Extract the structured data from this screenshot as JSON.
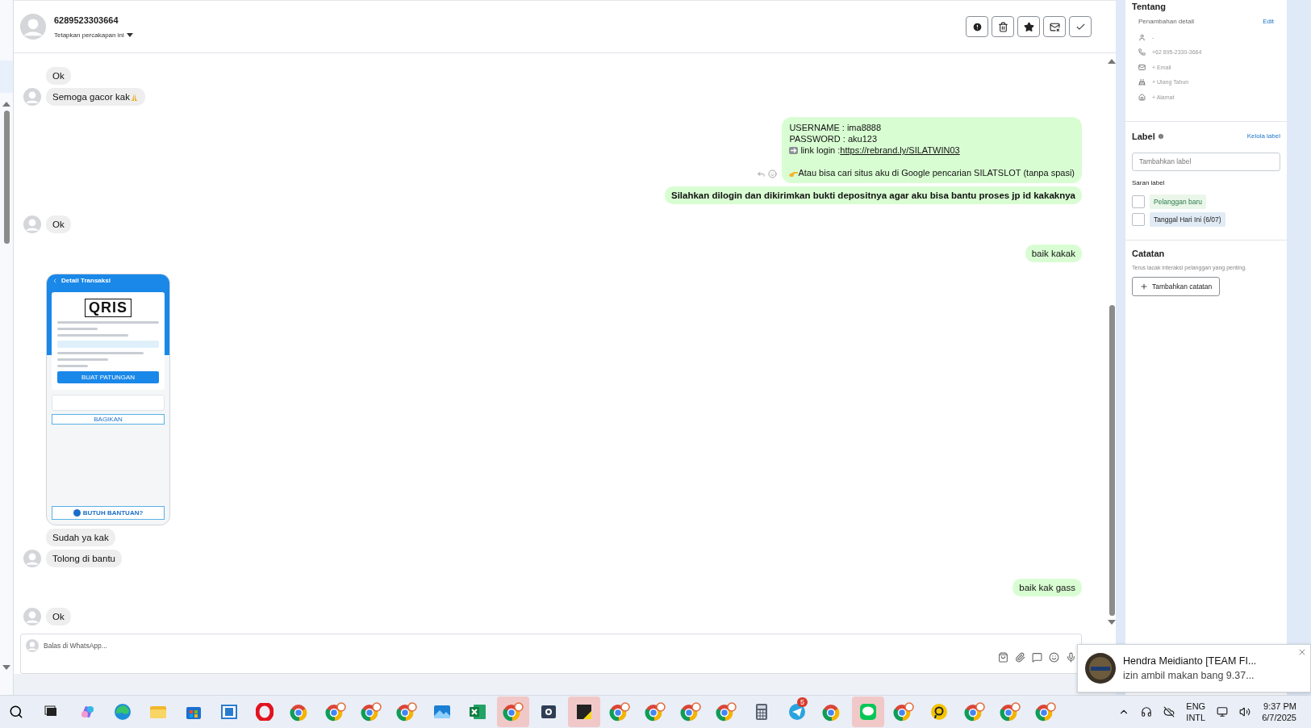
{
  "header": {
    "contact": "6289523303664",
    "assign": "Tetapkan percakapan ini"
  },
  "messages": [
    {
      "kind": "text",
      "outgoing": false,
      "text": "Ok"
    },
    {
      "kind": "text",
      "outgoing": false,
      "text": "Semoga gacor kak",
      "emoji_after": true
    },
    {
      "kind": "lines",
      "outgoing": true,
      "actions": true,
      "lines": [
        {
          "kind": "plain",
          "text": "USERNAME : ima8888"
        },
        {
          "kind": "plain",
          "text": "PASSWORD : aku123"
        },
        {
          "kind": "arrow",
          "text": "link login : ",
          "link": "https://rebrand.ly/SILATWIN03"
        },
        {
          "kind": "hand",
          "text": "Atau bisa cari situs aku di Google pencarian SILATSLOT (tanpa spasi)",
          "gap_before": true
        }
      ]
    },
    {
      "kind": "text",
      "outgoing": true,
      "bold": true,
      "text": "Silahkan dilogin dan dikirimkan bukti depositnya agar aku bisa bantu proses jp id kakaknya"
    },
    {
      "kind": "text",
      "outgoing": false,
      "text": "Ok"
    },
    {
      "kind": "text",
      "outgoing": true,
      "text": "baik kakak"
    },
    {
      "kind": "image",
      "outgoing": false,
      "title": "Detail Transaksi",
      "logo": "QRIS",
      "button": "BUAT PATUNGAN",
      "share": "BAGIKAN",
      "help": "BUTUH BANTUAN?"
    },
    {
      "kind": "text",
      "outgoing": false,
      "text": "Sudah ya kak"
    },
    {
      "kind": "text",
      "outgoing": false,
      "text": "Tolong di bantu"
    },
    {
      "kind": "text",
      "outgoing": true,
      "text": "baik kak gass"
    },
    {
      "kind": "text",
      "outgoing": false,
      "text": "Ok"
    }
  ],
  "composer": {
    "placeholder": "Balas di WhatsApp..."
  },
  "about": {
    "title": "Tentang",
    "subtitle": "Penambahan detail",
    "edit": "Edit",
    "details": [
      {
        "kind": "person",
        "text": "-"
      },
      {
        "kind": "phone",
        "text": "+62 895-2330-3664"
      },
      {
        "kind": "email",
        "text": "+ Email"
      },
      {
        "kind": "birthday",
        "text": "+ Ulang Tahun"
      },
      {
        "kind": "address",
        "text": "+ Alamat"
      }
    ]
  },
  "labels": {
    "title": "Label",
    "manage": "Kelola label",
    "placeholder": "Tambahkan label",
    "suggest_title": "Saran label",
    "suggestions": [
      {
        "text": "Pelanggan baru",
        "checked": false,
        "color": "#eaf6e9"
      },
      {
        "text": "Tanggal Hari Ini (6/07)",
        "checked": false,
        "color": "#e1ebf5"
      }
    ]
  },
  "notes": {
    "title": "Catatan",
    "hint": "Terus lacak interaksi pelanggan yang penting.",
    "button": "Tambahkan catatan"
  },
  "toast": {
    "title": "Hendra Meidianto [TEAM FI...",
    "body": "izin ambil makan bang 9.37..."
  },
  "taskbar": {
    "apps": [
      {
        "kind": "search",
        "selected": false
      },
      {
        "kind": "taskview",
        "selected": false
      },
      {
        "kind": "copilot",
        "selected": false
      },
      {
        "kind": "edge",
        "selected": false
      },
      {
        "kind": "folder",
        "selected": false
      },
      {
        "kind": "store",
        "selected": false
      },
      {
        "kind": "window",
        "selected": false
      },
      {
        "kind": "opera",
        "selected": false
      },
      {
        "kind": "chrome",
        "selected": false
      },
      {
        "kind": "chrome-profile",
        "selected": false
      },
      {
        "kind": "chrome-profile",
        "selected": false
      },
      {
        "kind": "chrome-profile",
        "selected": false
      },
      {
        "kind": "photos",
        "selected": false
      },
      {
        "kind": "excel",
        "selected": false
      },
      {
        "kind": "chrome-profile",
        "selected": true
      },
      {
        "kind": "box",
        "selected": false
      },
      {
        "kind": "sticky",
        "selected": true
      },
      {
        "kind": "chrome-profile",
        "selected": false
      },
      {
        "kind": "chrome-profile",
        "selected": false
      },
      {
        "kind": "chrome-profile",
        "selected": false
      },
      {
        "kind": "chrome-profile",
        "selected": false
      },
      {
        "kind": "calculator",
        "selected": false
      },
      {
        "kind": "telegram",
        "selected": false,
        "badge": "5"
      },
      {
        "kind": "chrome",
        "selected": false
      },
      {
        "kind": "line",
        "selected": true
      },
      {
        "kind": "chrome-profile",
        "selected": false
      },
      {
        "kind": "yellow",
        "selected": false
      },
      {
        "kind": "chrome-profile",
        "selected": false
      },
      {
        "kind": "chrome-profile",
        "selected": false
      },
      {
        "kind": "chrome-profile",
        "selected": false
      }
    ],
    "lang": "ENG",
    "layout": "INTL",
    "time": "9:37 PM",
    "date": "6/7/2025"
  }
}
